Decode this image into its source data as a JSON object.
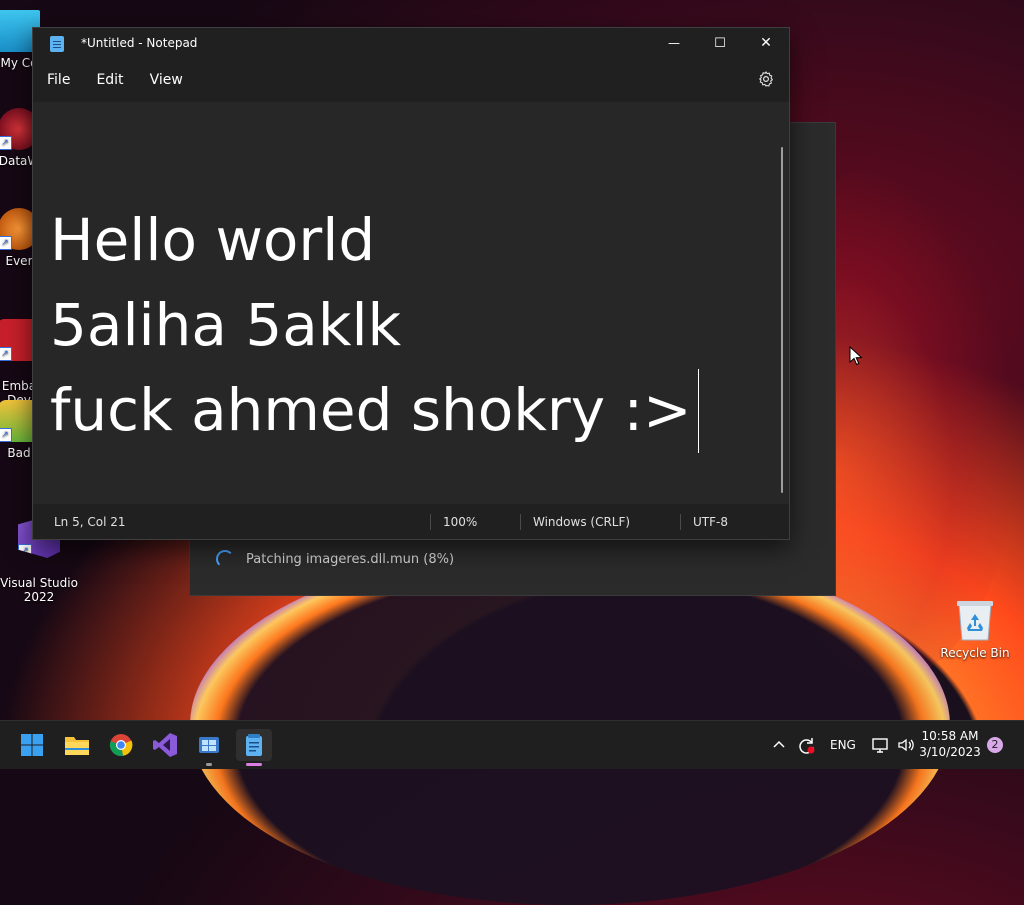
{
  "desktop": {
    "icons": [
      {
        "label": "My Co",
        "icon": "computer-icon"
      },
      {
        "label": "DataW",
        "icon": "datawedge-icon"
      },
      {
        "label": "Ever",
        "icon": "everything-icon"
      },
      {
        "label": "Emba\nDev",
        "icon": "embarcadero-dev-icon"
      },
      {
        "label": "Bad",
        "icon": "bad-piggies-icon"
      },
      {
        "label": "Visual Studio\n2022",
        "icon": "visual-studio-icon"
      }
    ],
    "recycle_bin": {
      "label": "Recycle Bin",
      "icon": "recycle-bin-icon"
    }
  },
  "background_dialog": {
    "status_text": "Patching imageres.dll.mun (8%)",
    "progress_percent": 8
  },
  "notepad": {
    "title": "*Untitled - Notepad",
    "window_controls": {
      "minimize": "—",
      "maximize": "☐",
      "close": "✕"
    },
    "menu": [
      "File",
      "Edit",
      "View"
    ],
    "settings_icon": "gear-icon",
    "content_lines": [
      "Hello world",
      "5aliha 5aklk",
      "fuck ahmed shokry :>"
    ],
    "status": {
      "position": "Ln 5, Col 21",
      "zoom": "100%",
      "line_ending": "Windows (CRLF)",
      "encoding": "UTF-8"
    }
  },
  "taskbar": {
    "apps": [
      "start-icon",
      "file-explorer-icon",
      "chrome-icon",
      "visual-studio-icon",
      "windows-app-icon",
      "notepad-icon"
    ],
    "tray": {
      "chevron_icon": "chevron-up-icon",
      "update_icon": "update-icon",
      "language": "ENG",
      "network_icon": "network-icon",
      "volume_icon": "volume-icon"
    },
    "time": "10:58 AM",
    "date": "3/10/2023",
    "notification_count": "2"
  },
  "colors": {
    "accent": "#5fb2f2",
    "notepad_bg": "#272727",
    "taskbar_bg": "#1f1f1f",
    "badge": "#d8a8e8"
  }
}
